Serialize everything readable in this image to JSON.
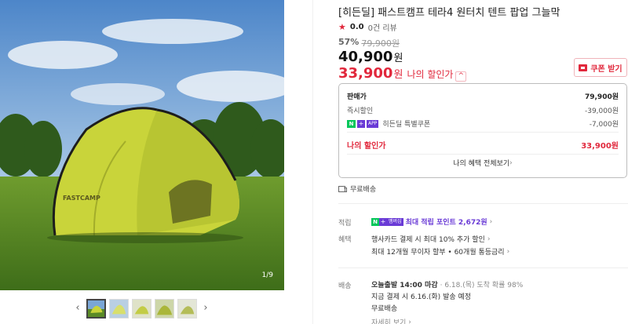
{
  "product": {
    "title": "[히든딜] 패스트캠프 테라4 원터치 텐트 팝업 그늘막",
    "image_counter": "1/9",
    "tent_brand_print": "FASTCAMP"
  },
  "rating": {
    "star": "★",
    "score": "0.0",
    "reviews": "0건 리뷰"
  },
  "pricing": {
    "discount_rate": "57%",
    "original_price": "79,900원",
    "sale_price": "40,900",
    "sale_unit": "원",
    "my_price": "33,900",
    "my_unit": "원",
    "my_price_label": "나의 할인가",
    "caret": "^"
  },
  "coupon": {
    "label": "쿠폰 받기"
  },
  "price_breakdown": {
    "rows": [
      {
        "label": "판매가",
        "value": "79,900원"
      },
      {
        "label": "즉시할인",
        "value": "-39,000원"
      },
      {
        "label": "히든딜 특별쿠폰",
        "value": "-7,000원",
        "badges": [
          "N",
          "+",
          "APP"
        ]
      }
    ],
    "total_label": "나의 할인가",
    "total_value": "33,900원",
    "more_label": "나의 혜택 전체보기"
  },
  "shipping": {
    "free_label": "무료배송"
  },
  "sections": {
    "points": {
      "label": "적립",
      "badge_n": "N",
      "badge_plus": "+",
      "badge_member": "멤버십",
      "text": "최대 적립 포인트 2,672원"
    },
    "benefits": {
      "label": "혜택",
      "lines": [
        "행사카드 결제 시 최대 10% 추가 할인",
        "최대 12개월 무이자 할부 • 60개월 통등금리"
      ]
    },
    "delivery": {
      "label": "배송",
      "line1_bold": "오늘출발 14:00 마감",
      "line1_rest": "· 6.18.(목) 도착 확률 98%",
      "line2": "지금 결제 시 6.16.(화) 발송 예정",
      "line3": "무료배송",
      "line4": "자세히 보기"
    }
  },
  "thumbnails": {
    "prev": "‹",
    "next": "›",
    "count": 5
  },
  "colors": {
    "accent": "#e1283c",
    "naver_green": "#03c75a",
    "membership_purple": "#6a3bd6"
  }
}
